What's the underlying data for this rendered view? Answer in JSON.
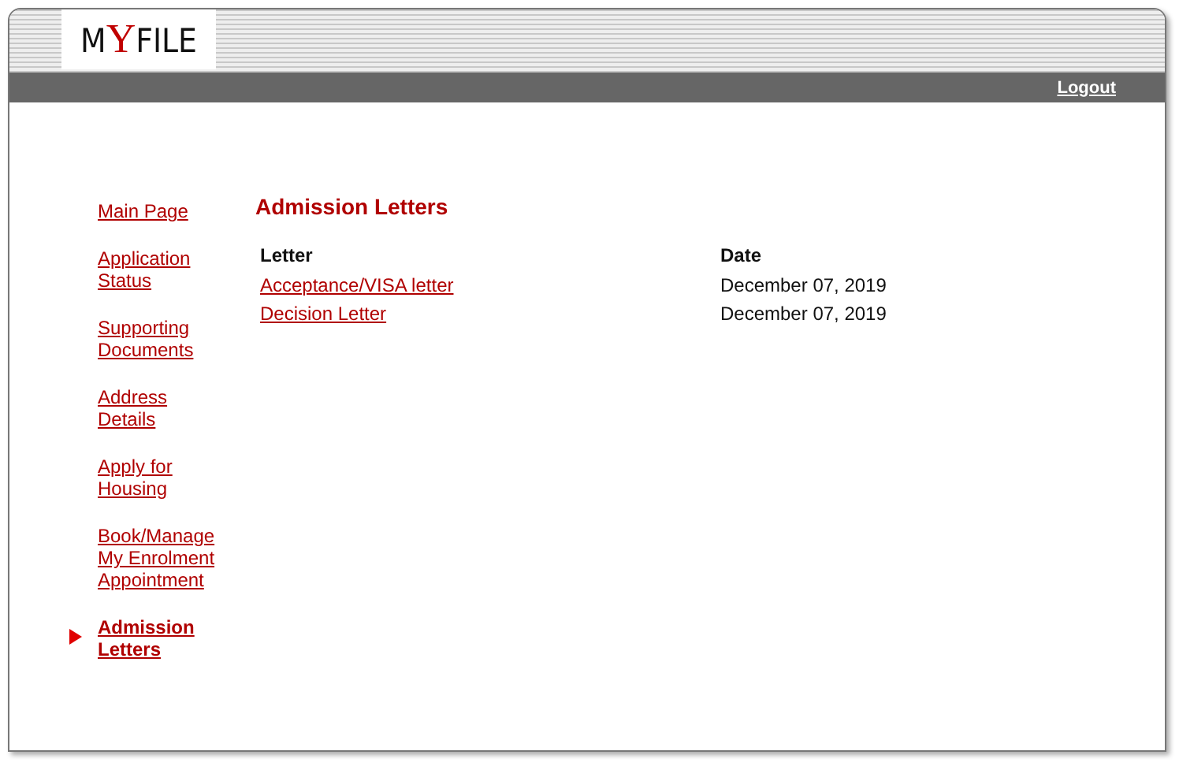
{
  "logo": {
    "prefix": "M",
    "accent": "Y",
    "suffix": "FILE"
  },
  "logout": "Logout",
  "nav": [
    {
      "lines": [
        "Main Page"
      ],
      "selected": false
    },
    {
      "lines": [
        "Application",
        "Status"
      ],
      "selected": false
    },
    {
      "lines": [
        "Supporting",
        "Documents"
      ],
      "selected": false
    },
    {
      "lines": [
        "Address",
        "Details"
      ],
      "selected": false
    },
    {
      "lines": [
        "Apply for",
        "Housing"
      ],
      "selected": false
    },
    {
      "lines": [
        "Book/Manage",
        "My Enrolment",
        "Appointment"
      ],
      "selected": false
    },
    {
      "lines": [
        "Admission",
        "Letters"
      ],
      "selected": true
    }
  ],
  "title": "Admission Letters",
  "table": {
    "columns": [
      "Letter",
      "Date"
    ],
    "rows": [
      {
        "letter": "Acceptance/VISA letter",
        "date": "December 07, 2019"
      },
      {
        "letter": "Decision Letter",
        "date": "December 07, 2019"
      }
    ]
  }
}
